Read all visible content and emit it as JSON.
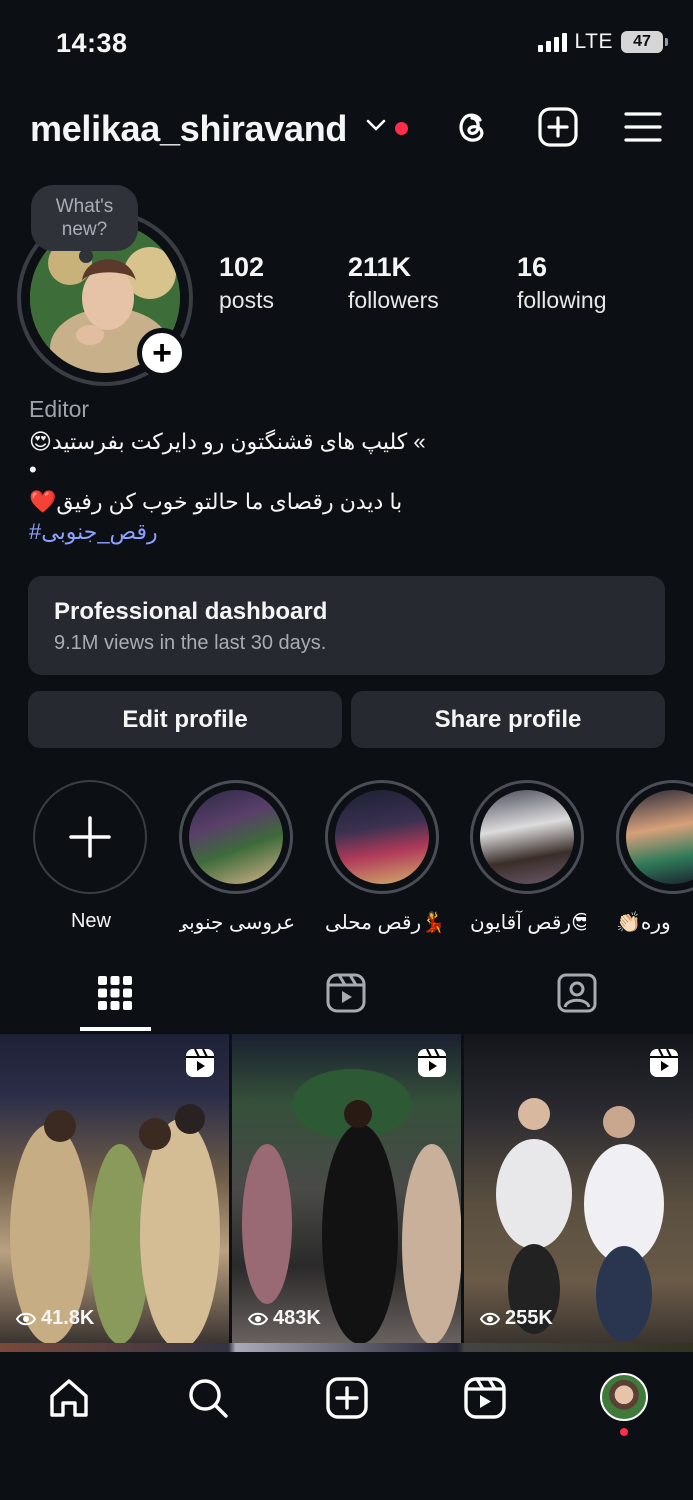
{
  "status_bar": {
    "time": "14:38",
    "network": "LTE",
    "battery": "47"
  },
  "header": {
    "username": "melikaa_shiravand",
    "icons": [
      "chevron-down-icon",
      "threads-icon",
      "create-icon",
      "menu-icon"
    ]
  },
  "profile": {
    "note_text": "What's new?",
    "stats": [
      {
        "value": "102",
        "label": "posts"
      },
      {
        "value": "211K",
        "label": "followers"
      },
      {
        "value": "16",
        "label": "following"
      }
    ],
    "category": "Editor",
    "bio_line1": "» کلیپ های قشنگتون رو دایرکت بفرستید😍",
    "bio_line2": "•",
    "bio_line3": "با دیدن رقصای ما حالتو خوب کن رفیق❤️",
    "hashtag": "#رقص_جنوبی"
  },
  "dashboard": {
    "title": "Professional dashboard",
    "subtitle": "9.1M views in the last 30 days."
  },
  "buttons": {
    "edit": "Edit profile",
    "share": "Share profile"
  },
  "highlights": [
    {
      "label": "New"
    },
    {
      "label": "عروسی جنوبی..."
    },
    {
      "label": "رقص محلی💃"
    },
    {
      "label": "رقص آقایون😎"
    },
    {
      "label": "👏🏻وره"
    }
  ],
  "tabs": [
    "grid-icon",
    "reels-icon",
    "tagged-icon"
  ],
  "posts": [
    {
      "views": "41.8K"
    },
    {
      "views": "483K"
    },
    {
      "views": "255K"
    }
  ],
  "navbar": [
    "home-icon",
    "search-icon",
    "create-icon",
    "reels-icon",
    "profile-avatar"
  ],
  "colors": {
    "background": "#0c0f14",
    "surface": "#262930",
    "accent_red": "#ff2d4a",
    "link": "#8da1ff"
  }
}
